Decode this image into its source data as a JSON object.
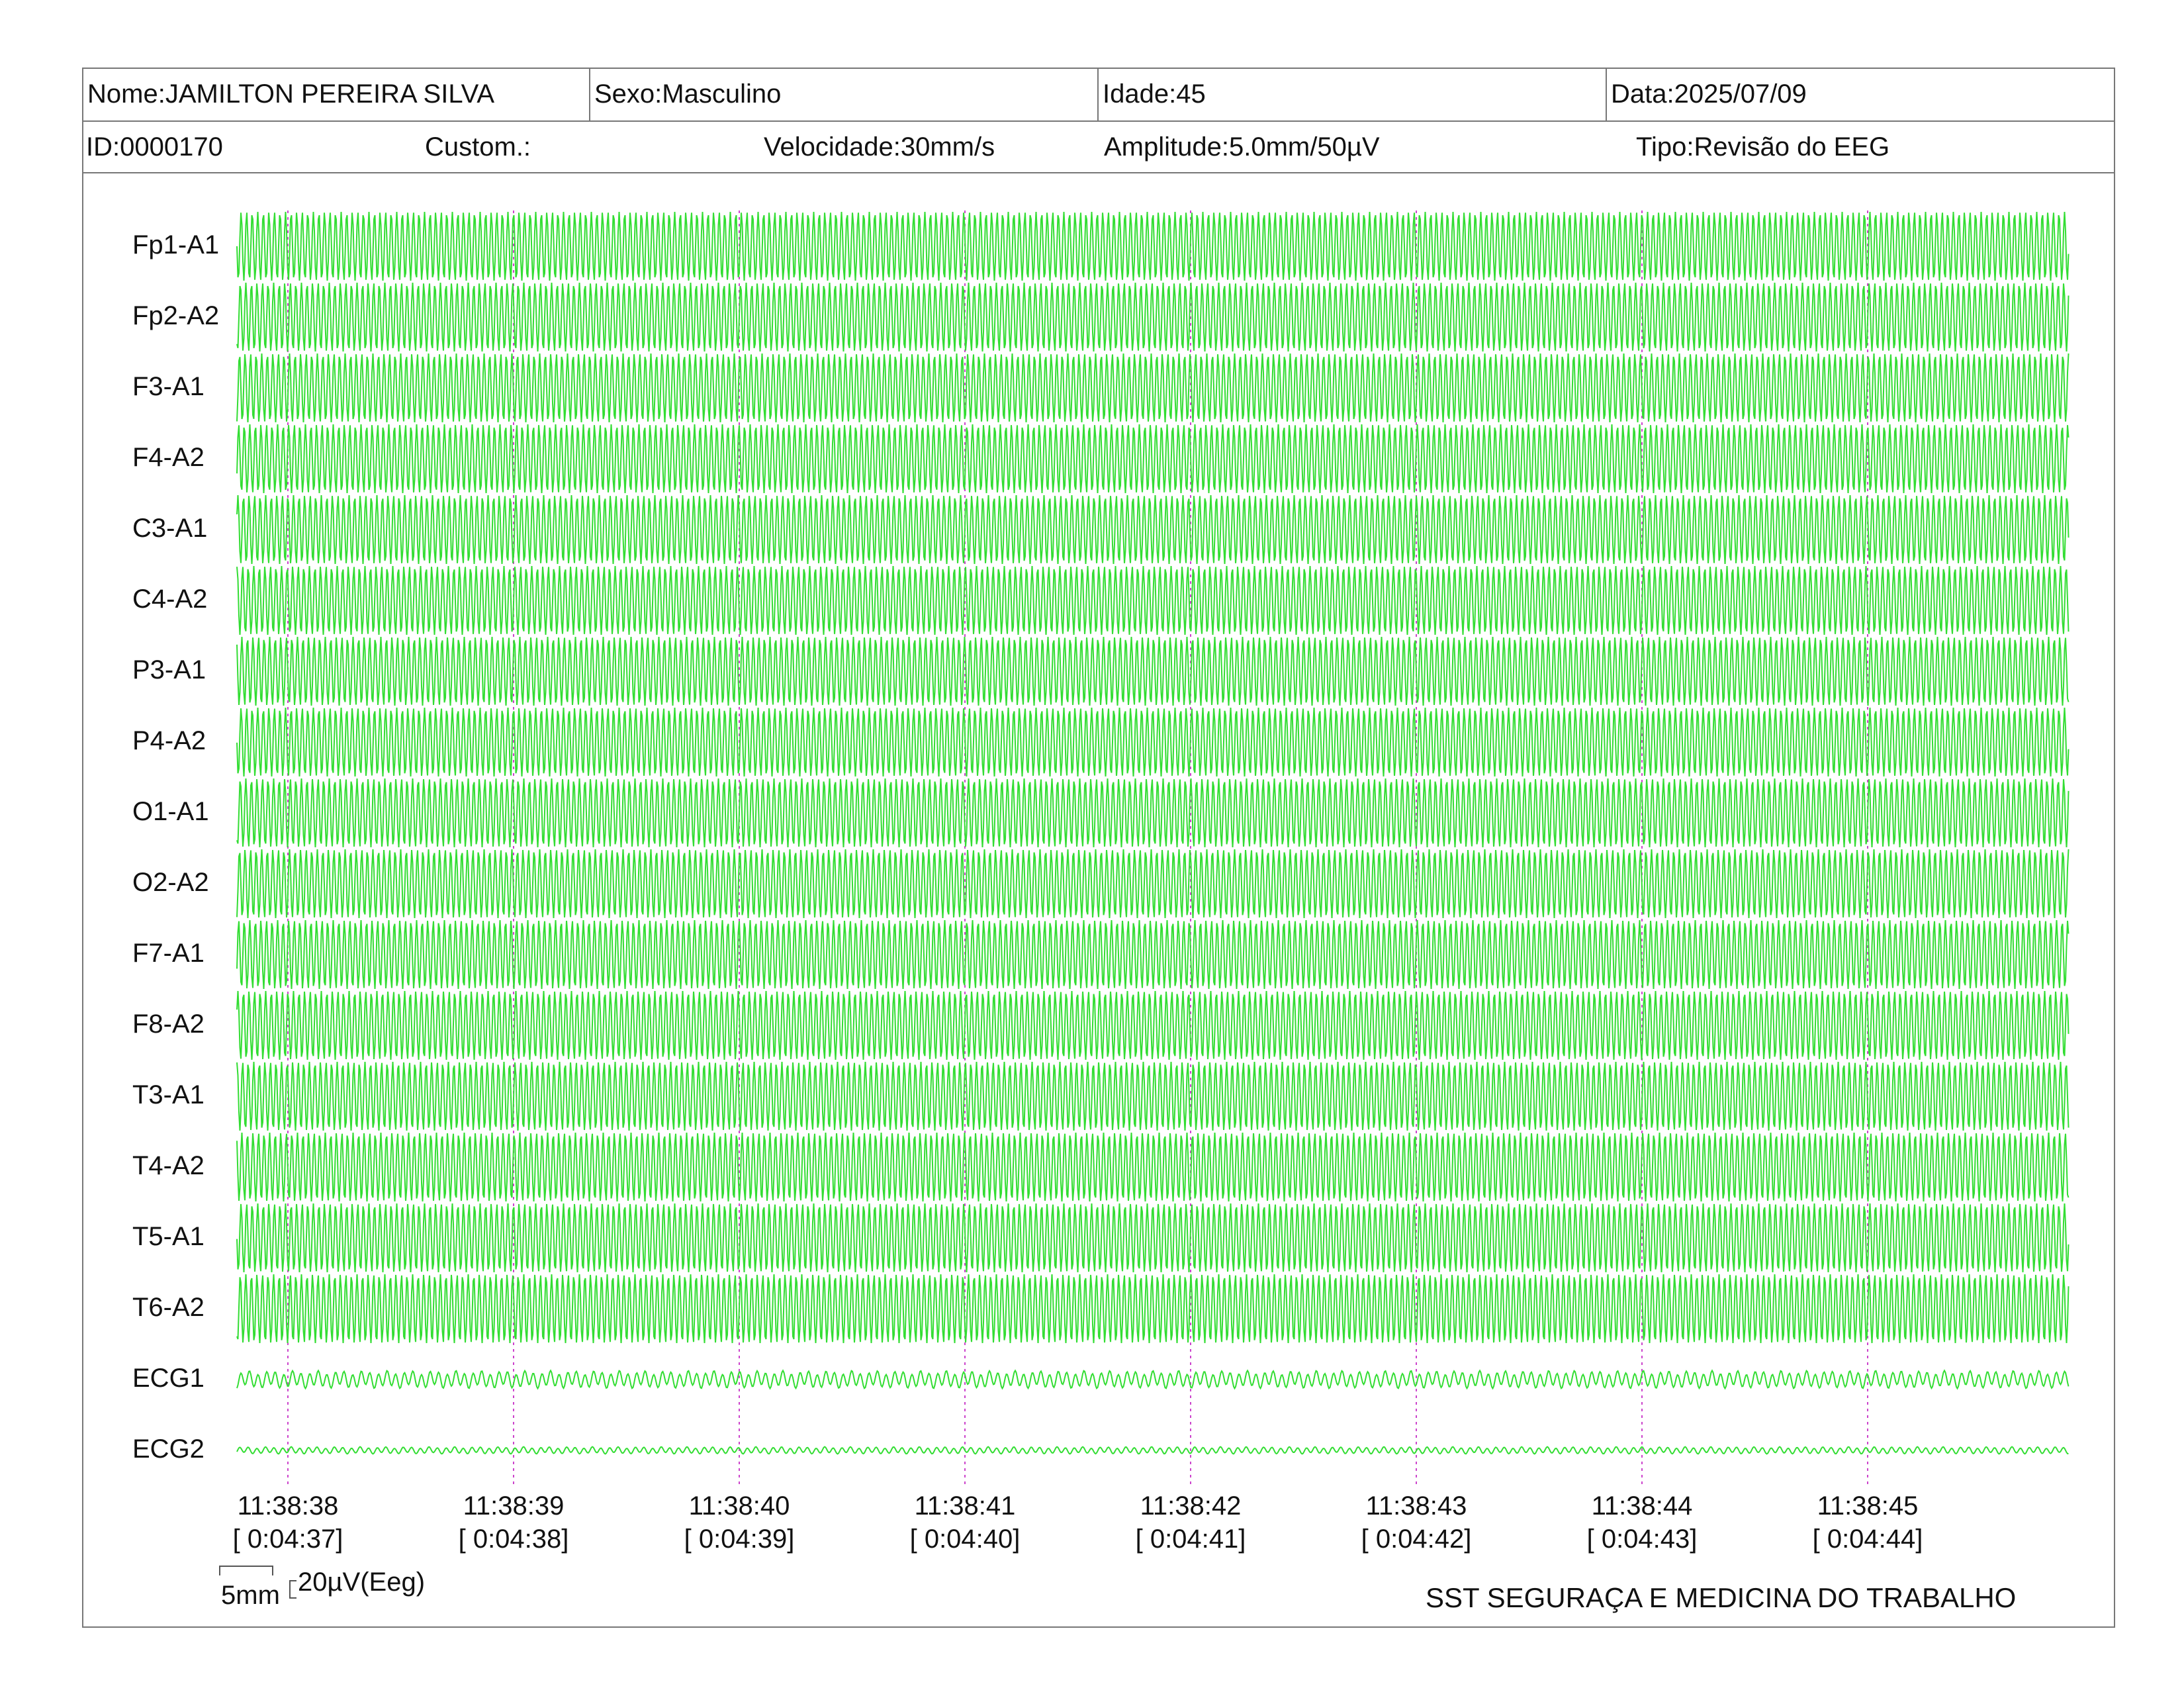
{
  "header": {
    "nome": "Nome:JAMILTON PEREIRA SILVA",
    "sexo": "Sexo:Masculino",
    "idade": "Idade:45",
    "data": "Data:2025/07/09",
    "id": "ID:0000170",
    "custom": "Custom.:",
    "velocidade": "Velocidade:30mm/s",
    "amplitude": "Amplitude:5.0mm/50µV",
    "tipo": "Tipo:Revisão do EEG"
  },
  "channels": [
    {
      "label": "Fp1-A1",
      "kind": "eeg",
      "amp": 1.0
    },
    {
      "label": "Fp2-A2",
      "kind": "eeg",
      "amp": 1.0
    },
    {
      "label": "F3-A1",
      "kind": "eeg",
      "amp": 1.0
    },
    {
      "label": "F4-A2",
      "kind": "eeg",
      "amp": 1.0
    },
    {
      "label": "C3-A1",
      "kind": "eeg",
      "amp": 1.0
    },
    {
      "label": "C4-A2",
      "kind": "eeg",
      "amp": 1.0
    },
    {
      "label": "P3-A1",
      "kind": "eeg",
      "amp": 1.0
    },
    {
      "label": "P4-A2",
      "kind": "eeg",
      "amp": 1.0
    },
    {
      "label": "O1-A1",
      "kind": "eeg",
      "amp": 1.0
    },
    {
      "label": "O2-A2",
      "kind": "eeg",
      "amp": 1.0
    },
    {
      "label": "F7-A1",
      "kind": "eeg",
      "amp": 1.0
    },
    {
      "label": "F8-A2",
      "kind": "eeg",
      "amp": 1.0
    },
    {
      "label": "T3-A1",
      "kind": "eeg",
      "amp": 1.0
    },
    {
      "label": "T4-A2",
      "kind": "eeg",
      "amp": 1.0
    },
    {
      "label": "T5-A1",
      "kind": "eeg",
      "amp": 1.0
    },
    {
      "label": "T6-A2",
      "kind": "eeg",
      "amp": 1.0
    },
    {
      "label": "ECG1",
      "kind": "ecg",
      "amp": 0.2
    },
    {
      "label": "ECG2",
      "kind": "ecg",
      "amp": 0.08
    }
  ],
  "time_marks": [
    {
      "clock": "11:38:38",
      "elapsed": "[ 0:04:37]"
    },
    {
      "clock": "11:38:39",
      "elapsed": "[ 0:04:38]"
    },
    {
      "clock": "11:38:40",
      "elapsed": "[ 0:04:39]"
    },
    {
      "clock": "11:38:41",
      "elapsed": "[ 0:04:40]"
    },
    {
      "clock": "11:38:42",
      "elapsed": "[ 0:04:41]"
    },
    {
      "clock": "11:38:43",
      "elapsed": "[ 0:04:42]"
    },
    {
      "clock": "11:38:44",
      "elapsed": "[ 0:04:43]"
    },
    {
      "clock": "11:38:45",
      "elapsed": "[ 0:04:44]"
    }
  ],
  "scale": {
    "time_label": "5mm",
    "amp_label": "20µV(Eeg)"
  },
  "footer": "SST SEGURAÇA E MEDICINA DO TRABALHO",
  "colors": {
    "trace": "#33dd33",
    "marker": "#cc44cc",
    "border": "#777777"
  }
}
